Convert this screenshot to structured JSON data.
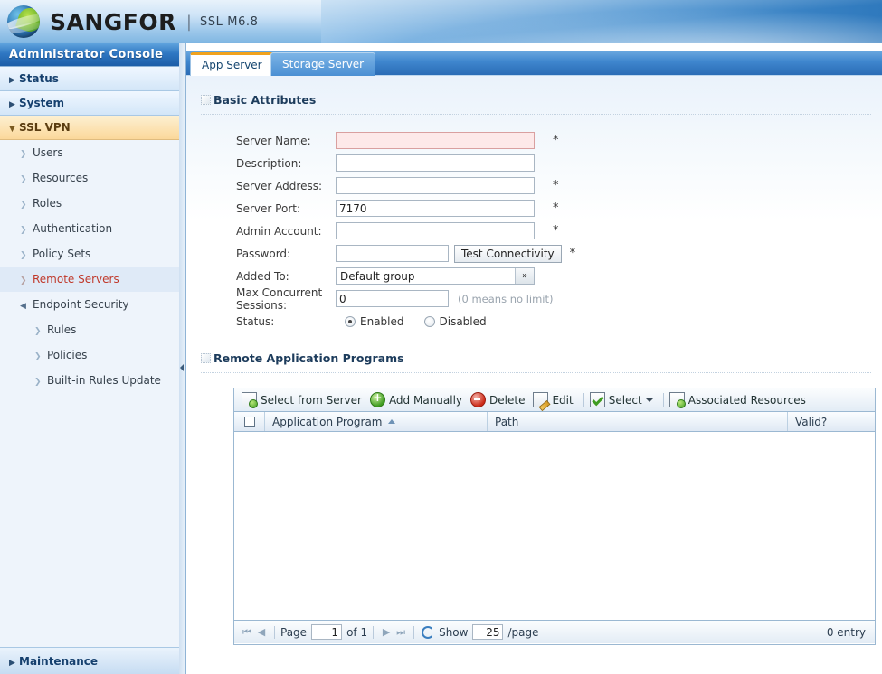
{
  "banner": {
    "logo_icon": "globe-logo",
    "brand": "SANGFOR",
    "separator": "|",
    "product": "SSL M6.8"
  },
  "sidebar": {
    "title": "Administrator Console",
    "groups": [
      {
        "label": "Status",
        "icon": "triangle-right-icon",
        "active": false
      },
      {
        "label": "System",
        "icon": "triangle-right-icon",
        "active": false
      },
      {
        "label": "SSL VPN",
        "icon": "triangle-down-icon",
        "active": true
      }
    ],
    "items": [
      {
        "label": "Users",
        "icon": "chevron-right-icon"
      },
      {
        "label": "Resources",
        "icon": "chevron-right-icon"
      },
      {
        "label": "Roles",
        "icon": "chevron-right-icon"
      },
      {
        "label": "Authentication",
        "icon": "chevron-right-icon"
      },
      {
        "label": "Policy Sets",
        "icon": "chevron-right-icon"
      },
      {
        "label": "Remote Servers",
        "icon": "chevron-right-icon"
      },
      {
        "label": "Endpoint Security",
        "icon": "triangle-down-small-icon"
      },
      {
        "label": "Rules",
        "icon": "chevron-right-icon"
      },
      {
        "label": "Policies",
        "icon": "chevron-right-icon"
      },
      {
        "label": "Built-in Rules Update",
        "icon": "chevron-right-icon"
      }
    ],
    "bottom": {
      "label": "Maintenance",
      "icon": "triangle-right-icon"
    }
  },
  "tabs": [
    {
      "label": "App Server",
      "active": true
    },
    {
      "label": "Storage Server",
      "active": false
    }
  ],
  "basic_attributes": {
    "section_title": "Basic Attributes",
    "fields": [
      {
        "label": "Server Name:",
        "value": "",
        "required": "*",
        "state": "focused-error"
      },
      {
        "label": "Description:",
        "value": "",
        "required": ""
      },
      {
        "label": "Server Address:",
        "value": "",
        "required": "*"
      },
      {
        "label": "Server Port:",
        "value": "7170",
        "required": "*"
      },
      {
        "label": "Admin Account:",
        "value": "",
        "required": "*"
      }
    ],
    "password": {
      "label": "Password:",
      "value": "",
      "required": "*",
      "button": "Test Connectivity"
    },
    "added_to": {
      "label": "Added To:",
      "value": "Default group",
      "browse_icon": "double-chevron-right-icon"
    },
    "max_sessions": {
      "label": "Max Concurrent Sessions:",
      "value": "0",
      "hint": "(0 means no limit)"
    },
    "status": {
      "label": "Status:",
      "options": [
        {
          "label": "Enabled",
          "selected": true
        },
        {
          "label": "Disabled",
          "selected": false
        }
      ]
    }
  },
  "remote_apps": {
    "section_title": "Remote Application Programs",
    "toolbar": [
      {
        "label": "Select from Server",
        "icon": "page-add-icon"
      },
      {
        "label": "Add Manually",
        "icon": "circle-plus-green-icon"
      },
      {
        "label": "Delete",
        "icon": "circle-minus-red-icon"
      },
      {
        "label": "Edit",
        "icon": "pencil-edit-icon"
      },
      {
        "label": "Select",
        "icon": "checkbox-check-icon",
        "has_dropdown": true
      },
      {
        "label": "Associated Resources",
        "icon": "page-add-icon"
      }
    ],
    "columns": [
      {
        "label": "Application Program",
        "sort": "asc"
      },
      {
        "label": "Path",
        "sort": ""
      },
      {
        "label": "Valid?",
        "sort": ""
      }
    ],
    "rows": [],
    "pager": {
      "first_icon": "first-page-icon",
      "prev_icon": "prev-page-icon",
      "page_label": "Page",
      "page_value": "1",
      "of_label": "of 1",
      "next_icon": "next-page-icon",
      "last_icon": "last-page-icon",
      "refresh_icon": "refresh-icon",
      "show_label": "Show",
      "page_size": "25",
      "per_page_label": "/page",
      "entry_count": "0 entry"
    }
  },
  "colors": {
    "accent_blue": "#2a6cb5",
    "tab_active_top": "#f0a21e",
    "selected_item": "#c0392b",
    "error_field_bg": "#fde9e9"
  }
}
